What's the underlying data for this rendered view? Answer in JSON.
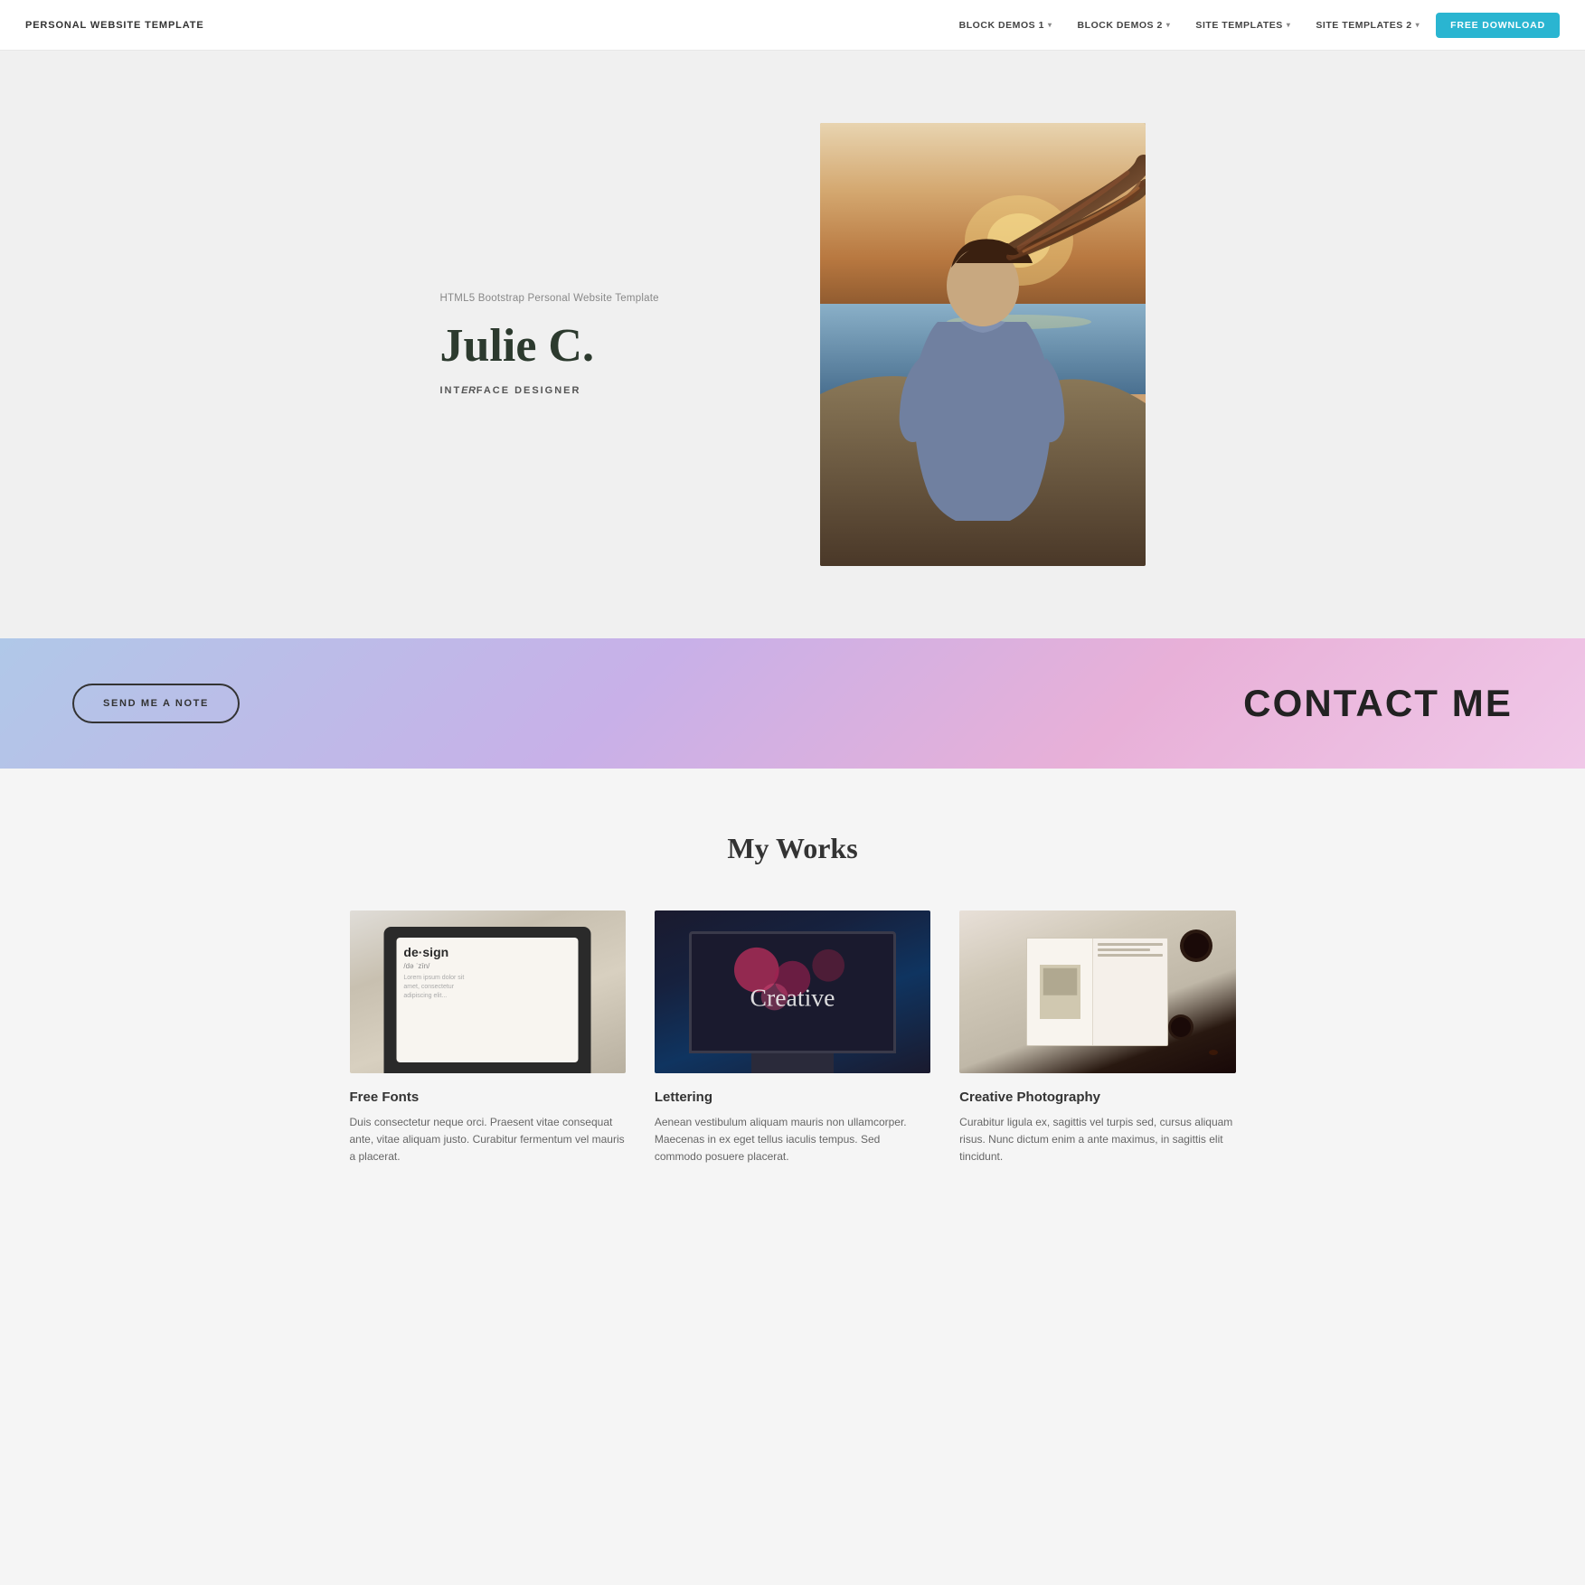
{
  "nav": {
    "brand": "PERSONAL WEBSITE TEMPLATE",
    "links": [
      {
        "label": "BLOCK DEMOS 1",
        "caret": true
      },
      {
        "label": "BLOCK DEMOS 2",
        "caret": true
      },
      {
        "label": "SITE TEMPLATES",
        "caret": true
      },
      {
        "label": "SITE TEMPLATES 2",
        "caret": true
      }
    ],
    "cta": "FREE DOWNLOAD"
  },
  "hero": {
    "subtitle": "HTML5 Bootstrap Personal Website Template",
    "name": "Julie C.",
    "role_prefix": "INT",
    "role_italic": "ER",
    "role_suffix": "FACE DESIGNER"
  },
  "contact": {
    "button_label": "SEND ME A NOTE",
    "title": "CONTACT ME"
  },
  "works": {
    "title": "My Works",
    "items": [
      {
        "title": "Free Fonts",
        "description": "Duis consectetur neque orci. Praesent vitae consequat ante, vitae aliquam justo. Curabitur fermentum vel mauris a placerat."
      },
      {
        "title": "Lettering",
        "description": "Aenean vestibulum aliquam mauris non ullamcorper. Maecenas in ex eget tellus iaculis tempus. Sed commodo posuere placerat."
      },
      {
        "title": "Creative Photography",
        "description": "Curabitur ligula ex, sagittis vel turpis sed, cursus aliquam risus. Nunc dictum enim a ante maximus, in sagittis elit tincidunt."
      }
    ]
  }
}
